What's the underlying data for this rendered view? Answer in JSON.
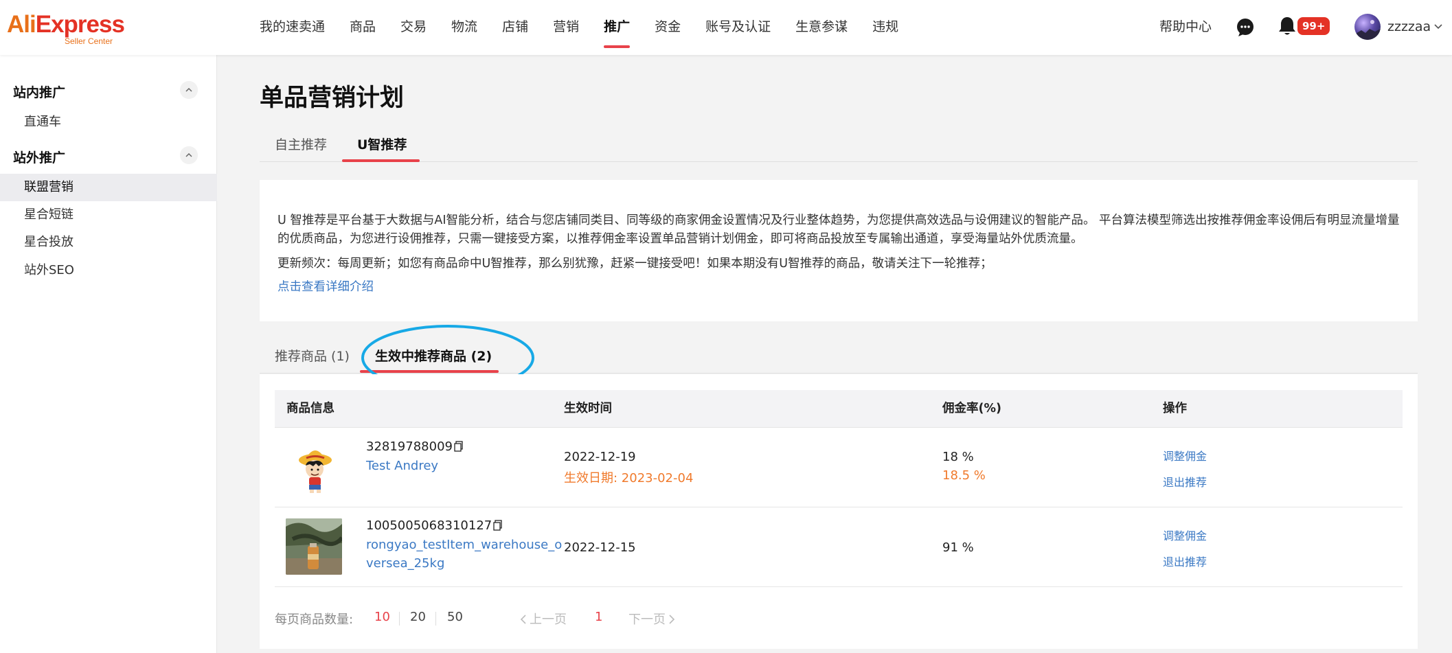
{
  "header": {
    "logo_main": "AliExpress",
    "logo_sub": "Seller Center",
    "nav": [
      "我的速卖通",
      "商品",
      "交易",
      "物流",
      "店铺",
      "营销",
      "推广",
      "资金",
      "账号及认证",
      "生意参谋",
      "违规"
    ],
    "active_nav": "推广",
    "help": "帮助中心",
    "notification_badge": "99+",
    "username": "zzzzaa"
  },
  "sidebar": {
    "group1": "站内推广",
    "group1_items": [
      "直通车"
    ],
    "group2": "站外推广",
    "group2_items": [
      "联盟营销",
      "星合短链",
      "星合投放",
      "站外SEO"
    ],
    "active_item": "联盟营销"
  },
  "page": {
    "title": "单品营销计划",
    "tabs": [
      "自主推荐",
      "U智推荐"
    ],
    "active_tab": "U智推荐"
  },
  "info": {
    "description": "U 智推荐是平台基于大数据与AI智能分析，结合与您店铺同类目、同等级的商家佣金设置情况及行业整体趋势，为您提供高效选品与设佣建议的智能产品。 平台算法模型筛选出按推荐佣金率设佣后有明显流量增量的优质商品，为您进行设佣推荐，只需一键接受方案，以推荐佣金率设置单品营销计划佣金，即可将商品投放至专属输出通道，享受海量站外优质流量。",
    "frequency": "更新频次：每周更新；如您有商品命中U智推荐，那么别犹豫，赶紧一键接受吧！如果本期没有U智推荐的商品，敬请关注下一轮推荐；",
    "detail_link": "点击查看详细介绍"
  },
  "subtabs": [
    "推荐商品 (1)",
    "生效中推荐商品 (2)"
  ],
  "active_subtab": "生效中推荐商品 (2)",
  "table": {
    "headers": [
      "商品信息",
      "生效时间",
      "佣金率(%)",
      "操作"
    ],
    "rows": [
      {
        "id": "32819788009",
        "name": "Test Andrey",
        "date": "2022-12-19",
        "effective": "生效日期: 2023-02-04",
        "rate": "18 %",
        "new_rate": "18.5 %",
        "actions": [
          "调整佣金",
          "退出推荐"
        ]
      },
      {
        "id": "1005005068310127",
        "name": "rongyao_testItem_warehouse_oversea_25kg",
        "date": "2022-12-15",
        "rate": "91 %",
        "actions": [
          "调整佣金",
          "退出推荐"
        ]
      }
    ]
  },
  "pagination": {
    "label": "每页商品数量:",
    "sizes": [
      "10",
      "20",
      "50"
    ],
    "selected_size": "10",
    "prev": "上一页",
    "current": "1",
    "next": "下一页"
  },
  "colors": {
    "accent_red": "#e8424a",
    "link_blue": "#3b79c4",
    "orange": "#f07a2c",
    "annotation_cyan": "#17a9e6"
  }
}
